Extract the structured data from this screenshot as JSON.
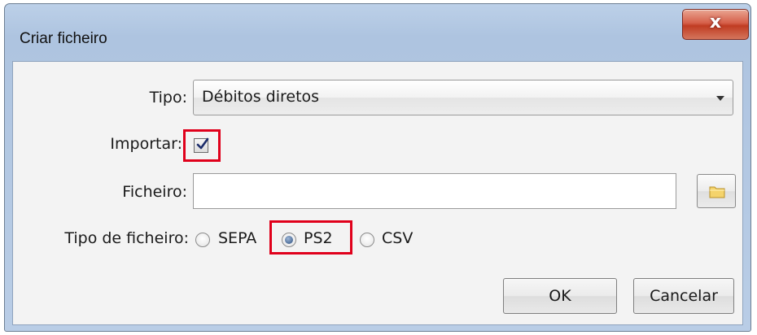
{
  "window": {
    "title": "Criar ficheiro",
    "close_glyph": "x"
  },
  "form": {
    "tipo_label": "Tipo:",
    "tipo_value": "Débitos diretos",
    "importar_label": "Importar:",
    "importar_checked": true,
    "ficheiro_label": "Ficheiro:",
    "ficheiro_value": "",
    "tipo_ficheiro_label": "Tipo de ficheiro:",
    "file_types": [
      {
        "label": "SEPA",
        "checked": false
      },
      {
        "label": "PS2",
        "checked": true
      },
      {
        "label": "CSV",
        "checked": false
      }
    ]
  },
  "buttons": {
    "ok": "OK",
    "cancel": "Cancelar",
    "browse_icon": "folder-icon"
  },
  "colors": {
    "highlight": "#e0001b",
    "titlebar": "#b9cde6",
    "close_button": "#c94b32"
  }
}
